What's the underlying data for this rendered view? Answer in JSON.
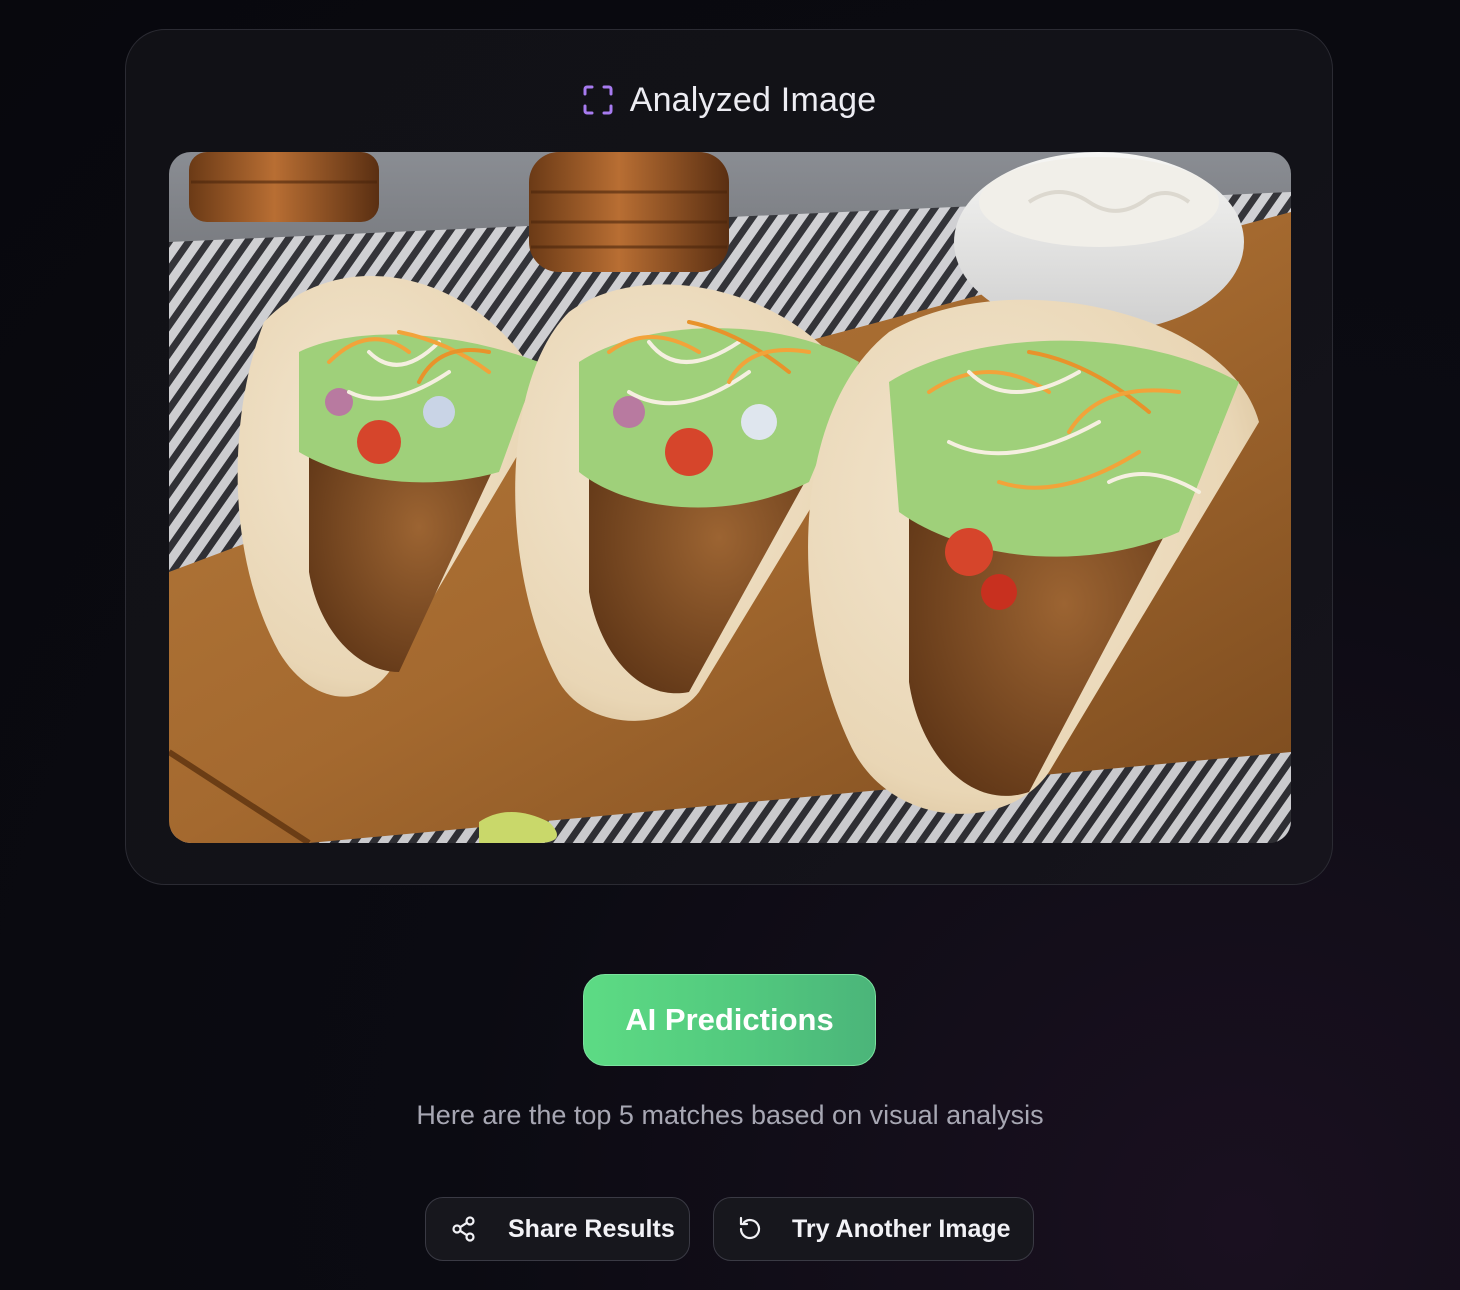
{
  "card": {
    "title": "Analyzed Image",
    "title_icon": "scan-frame-icon",
    "image_subject": "three soft-shell tacos with seasoned meat, lettuce, tomato, onion and shredded cheese on a wooden board",
    "accent_color": "#a77bf0"
  },
  "predictions": {
    "button_label": "AI Predictions",
    "button_color": "#5ddb84",
    "subtitle": "Here are the top 5 matches based on visual analysis"
  },
  "actions": {
    "share_label": "Share Results",
    "share_icon": "share-icon",
    "retry_label": "Try Another Image",
    "retry_icon": "refresh-icon"
  }
}
